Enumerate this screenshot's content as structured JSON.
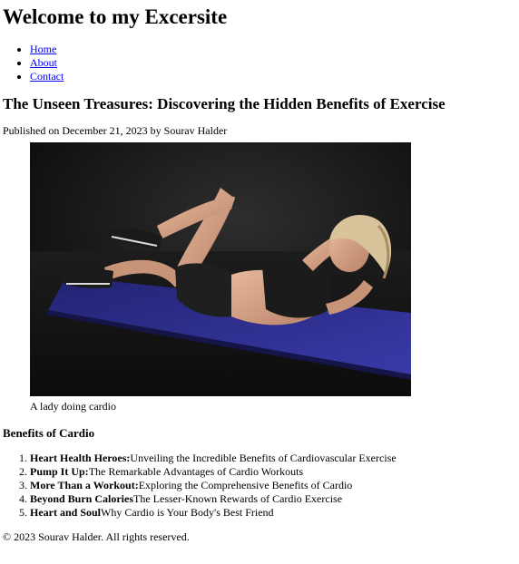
{
  "site": {
    "title": "Welcome to my Excersite"
  },
  "nav": {
    "items": [
      {
        "label": "Home"
      },
      {
        "label": "About"
      },
      {
        "label": "Contact"
      }
    ]
  },
  "article": {
    "title": "The Unseen Treasures: Discovering the Hidden Benefits of Exercise",
    "byline": "Published on December 21, 2023 by Sourav Halder",
    "image_caption": "A lady doing cardio"
  },
  "benefits": {
    "heading": "Benefits of Cardio",
    "items": [
      {
        "bold": "Heart Health Heroes:",
        "text": "Unveiling the Incredible Benefits of Cardiovascular Exercise"
      },
      {
        "bold": "Pump It Up:",
        "text": "The Remarkable Advantages of Cardio Workouts"
      },
      {
        "bold": "More Than a Workout:",
        "text": "Exploring the Comprehensive Benefits of Cardio"
      },
      {
        "bold": "Beyond Burn Calories",
        "text": "The Lesser-Known Rewards of Cardio Exercise"
      },
      {
        "bold": "Heart and Soul",
        "text": "Why Cardio is Your Body's Best Friend"
      }
    ]
  },
  "footer": {
    "text": "© 2023 Sourav Halder. All rights reserved."
  },
  "colors": {
    "link": "#0000ee",
    "mat": "#2b2a8c",
    "floor": "#141414"
  }
}
